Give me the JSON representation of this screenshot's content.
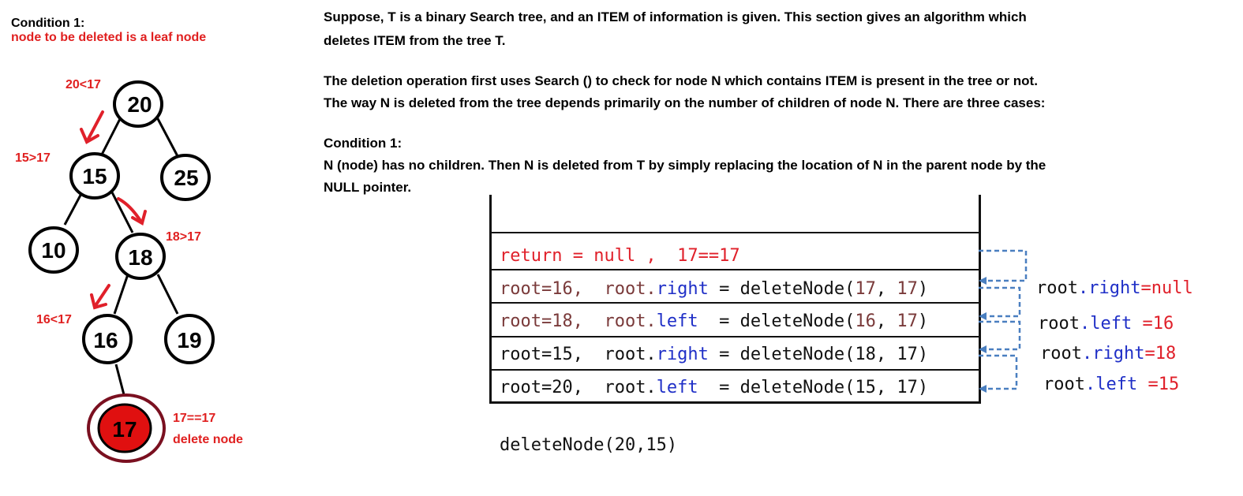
{
  "left_panel": {
    "heading": "Condition 1:",
    "subheading": "node to be deleted is a leaf node"
  },
  "tree": {
    "nodes": [
      "20",
      "15",
      "25",
      "10",
      "18",
      "16",
      "19",
      "17"
    ],
    "annotations": [
      "20<17",
      "15>17",
      "18>17",
      "16<17",
      "17==17",
      "delete node"
    ]
  },
  "text": {
    "p1_line1": "Suppose, T is a binary Search tree, and an ITEM of information is given. This section gives an algorithm which",
    "p1_line2": "deletes ITEM from the tree T.",
    "p2_line1": "The deletion operation first uses Search () to check for node N which contains ITEM is present in the tree or not.",
    "p2_line2": "The way N is deleted from the tree depends primarily on the number of children of node N. There are three cases:",
    "cond_title": "Condition 1:",
    "cond_line1": "N (node) has no children. Then N is deleted from T by simply replacing the location of N in the parent node by the",
    "cond_line2": "NULL pointer."
  },
  "stack": {
    "rows": [
      {
        "a": "return = null ,  ",
        "b": "17==17"
      },
      {
        "p1": "root=16,  ",
        "p2": "root.",
        "p3": "right",
        "p4": " = deleteNode(",
        "p5": "17",
        "p6": ", ",
        "p7": "17",
        "p8": ")"
      },
      {
        "p1": "root=18,  ",
        "p2": "root.",
        "p3": "left",
        "p4": "  = deleteNode(",
        "p5": "16",
        "p6": ", ",
        "p7": "17",
        "p8": ")"
      },
      {
        "p1": "root=15,  ",
        "p2": "root.",
        "p3": "right",
        "p4": " = deleteNode(18, 17)"
      },
      {
        "p1": "root=20,  ",
        "p2": "root.",
        "p3": "left",
        "p4": "  = deleteNode(15, 17)"
      }
    ],
    "call": "deleteNode(20,15)"
  },
  "returns": [
    {
      "a": "root",
      "b": ".right",
      "c": "=null"
    },
    {
      "a": "root",
      "b": ".left",
      "c": " =16"
    },
    {
      "a": "root",
      "b": ".right",
      "c": "=18"
    },
    {
      "a": "root",
      "b": ".left",
      "c": " =15"
    }
  ],
  "colors": {
    "red": "#e0202a",
    "blue": "#1f2fc7",
    "brown": "#7a3a3a",
    "dashed_arrow": "#4a7fc0",
    "dark_red_ring": "#7a1020"
  }
}
